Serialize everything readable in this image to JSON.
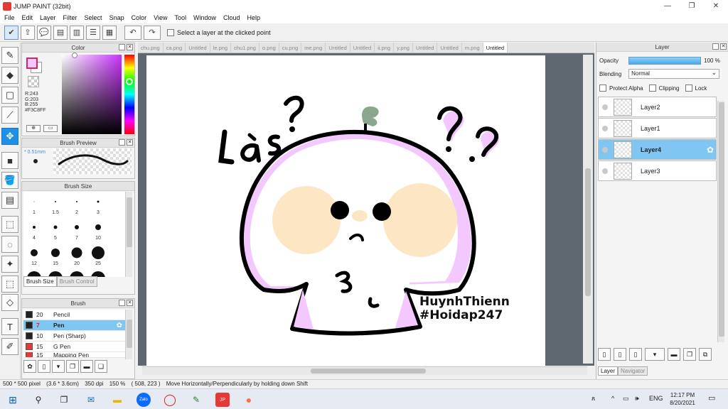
{
  "window": {
    "title": "JUMP PAINT (32bit)"
  },
  "menu": [
    "File",
    "Edit",
    "Layer",
    "Filter",
    "Select",
    "Snap",
    "Color",
    "View",
    "Tool",
    "Window",
    "Cloud",
    "Help"
  ],
  "toolbar": {
    "select_layer_label": "Select a layer at the clicked point"
  },
  "color_panel": {
    "title": "Color",
    "fg_color": "#F3C8FF",
    "r": "R:243",
    "g": "G:203",
    "b": "B:255",
    "hex": "#F3C8FF"
  },
  "brush_preview": {
    "title": "Brush Preview",
    "size": "0.51mm"
  },
  "brush_size": {
    "title": "Brush Size",
    "sizes": [
      "1",
      "1.5",
      "2",
      "3",
      "4",
      "5",
      "7",
      "10",
      "12",
      "15",
      "20",
      "25"
    ],
    "tab_active": "Brush Size",
    "tab_inactive": "Brush Control"
  },
  "brush_panel": {
    "title": "Brush",
    "items": [
      {
        "num": "20",
        "name": "Pencil",
        "color": "#222222"
      },
      {
        "num": "7",
        "name": "Pen",
        "color": "#222222"
      },
      {
        "num": "10",
        "name": "Pen (Sharp)",
        "color": "#222222"
      },
      {
        "num": "15",
        "name": "G Pen",
        "color": "#e53935"
      },
      {
        "num": "15",
        "name": "Mapping Pen",
        "color": "#e53935"
      }
    ]
  },
  "tabs": [
    "chu.png",
    "ca.png",
    "Untitled",
    "le.png",
    "chu1.png",
    "o.png",
    "cu.png",
    "me.png",
    "Untitled",
    "Untitled",
    "ii.png",
    "y.png",
    "Untitled",
    "Untitled",
    "m.png",
    "Untitled"
  ],
  "active_tab_index": 15,
  "artwork": {
    "text1": "Lá s?",
    "wm1": "HuynhThienn",
    "wm2": "#Hoidap247"
  },
  "layers": {
    "title": "Layer",
    "opacity_label": "Opacity",
    "opacity_value": "100 %",
    "blending_label": "Blending",
    "blending_value": "Normal",
    "protect_alpha": "Protect Alpha",
    "clipping": "Clipping",
    "lock": "Lock",
    "items": [
      "Layer2",
      "Layer1",
      "Layer4",
      "Layer3"
    ],
    "selected": "Layer4",
    "tab_active": "Layer",
    "tab_inactive": "Navigator"
  },
  "status": {
    "size": "500 * 500 pixel",
    "dims": "(3.6 * 3.6cm)",
    "dpi": "350 dpi",
    "zoom": "150 %",
    "coords": "( 508, 223 )",
    "hint": "Move Horizontally/Perpendicularly by holding down Shift"
  },
  "taskbar": {
    "lang": "ENG",
    "time": "12:17 PM",
    "date": "8/20/2021"
  }
}
